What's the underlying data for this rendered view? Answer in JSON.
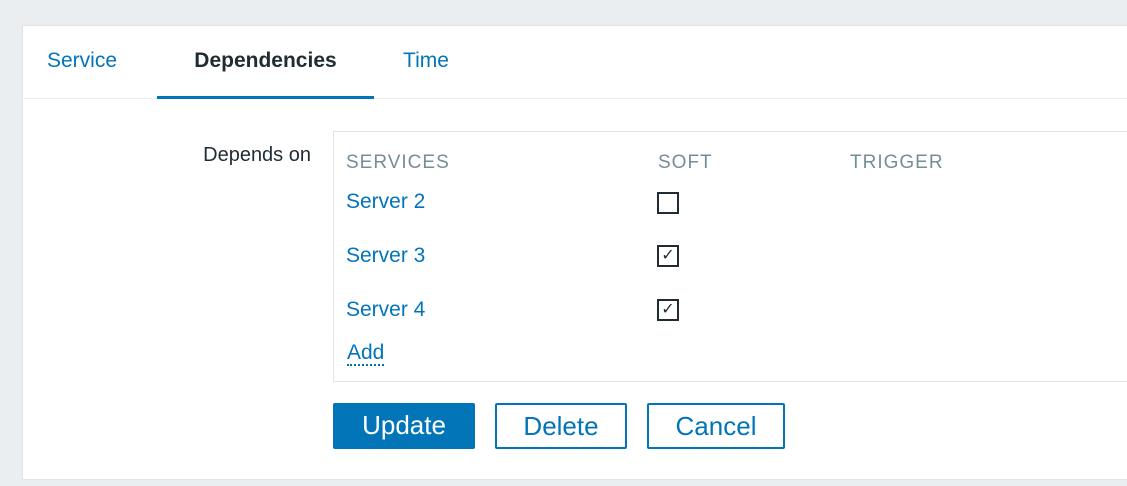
{
  "tabs": [
    {
      "label": "Service",
      "active": false
    },
    {
      "label": "Dependencies",
      "active": true
    },
    {
      "label": "Time",
      "active": false
    }
  ],
  "form": {
    "depends_on_label": "Depends on"
  },
  "dependencies_table": {
    "headers": {
      "services": "SERVICES",
      "soft": "SOFT",
      "trigger": "TRIGGER"
    },
    "rows": [
      {
        "service": "Server 2",
        "soft": false,
        "soft_mark": ""
      },
      {
        "service": "Server 3",
        "soft": true,
        "soft_mark": "✓"
      },
      {
        "service": "Server 4",
        "soft": true,
        "soft_mark": "✓"
      }
    ],
    "add_label": "Add"
  },
  "buttons": {
    "update": "Update",
    "delete": "Delete",
    "cancel": "Cancel"
  },
  "colors": {
    "accent": "#0275b8",
    "background": "#ebeef0",
    "header_text": "#768d99",
    "text": "#1f2c33"
  }
}
